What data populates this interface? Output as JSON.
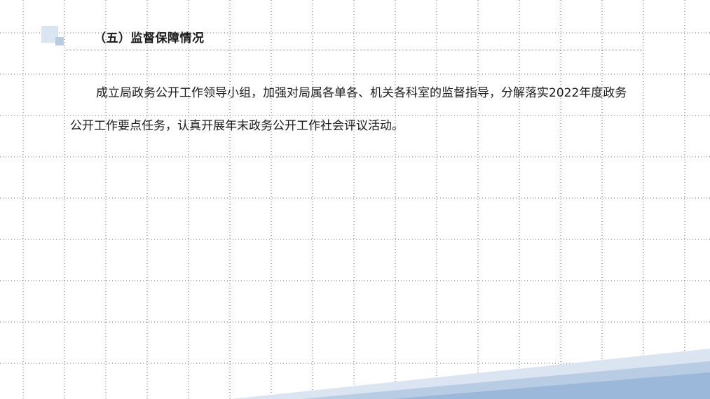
{
  "slide": {
    "section_title": "（五）监督保障情况",
    "paragraph": "成立局政务公开工作领导小组，加强对局属各单各、机关各科室的监督指导，分解落实2022年度政务公开工作要点任务，认真开展年末政务公开工作社会评议活动。"
  },
  "colors": {
    "accent_light": "#dbe5f1",
    "accent_mid": "#b8cce4",
    "accent_dark": "#95b3d7",
    "grid_dot": "#555555",
    "divider": "#8ea3bd"
  }
}
